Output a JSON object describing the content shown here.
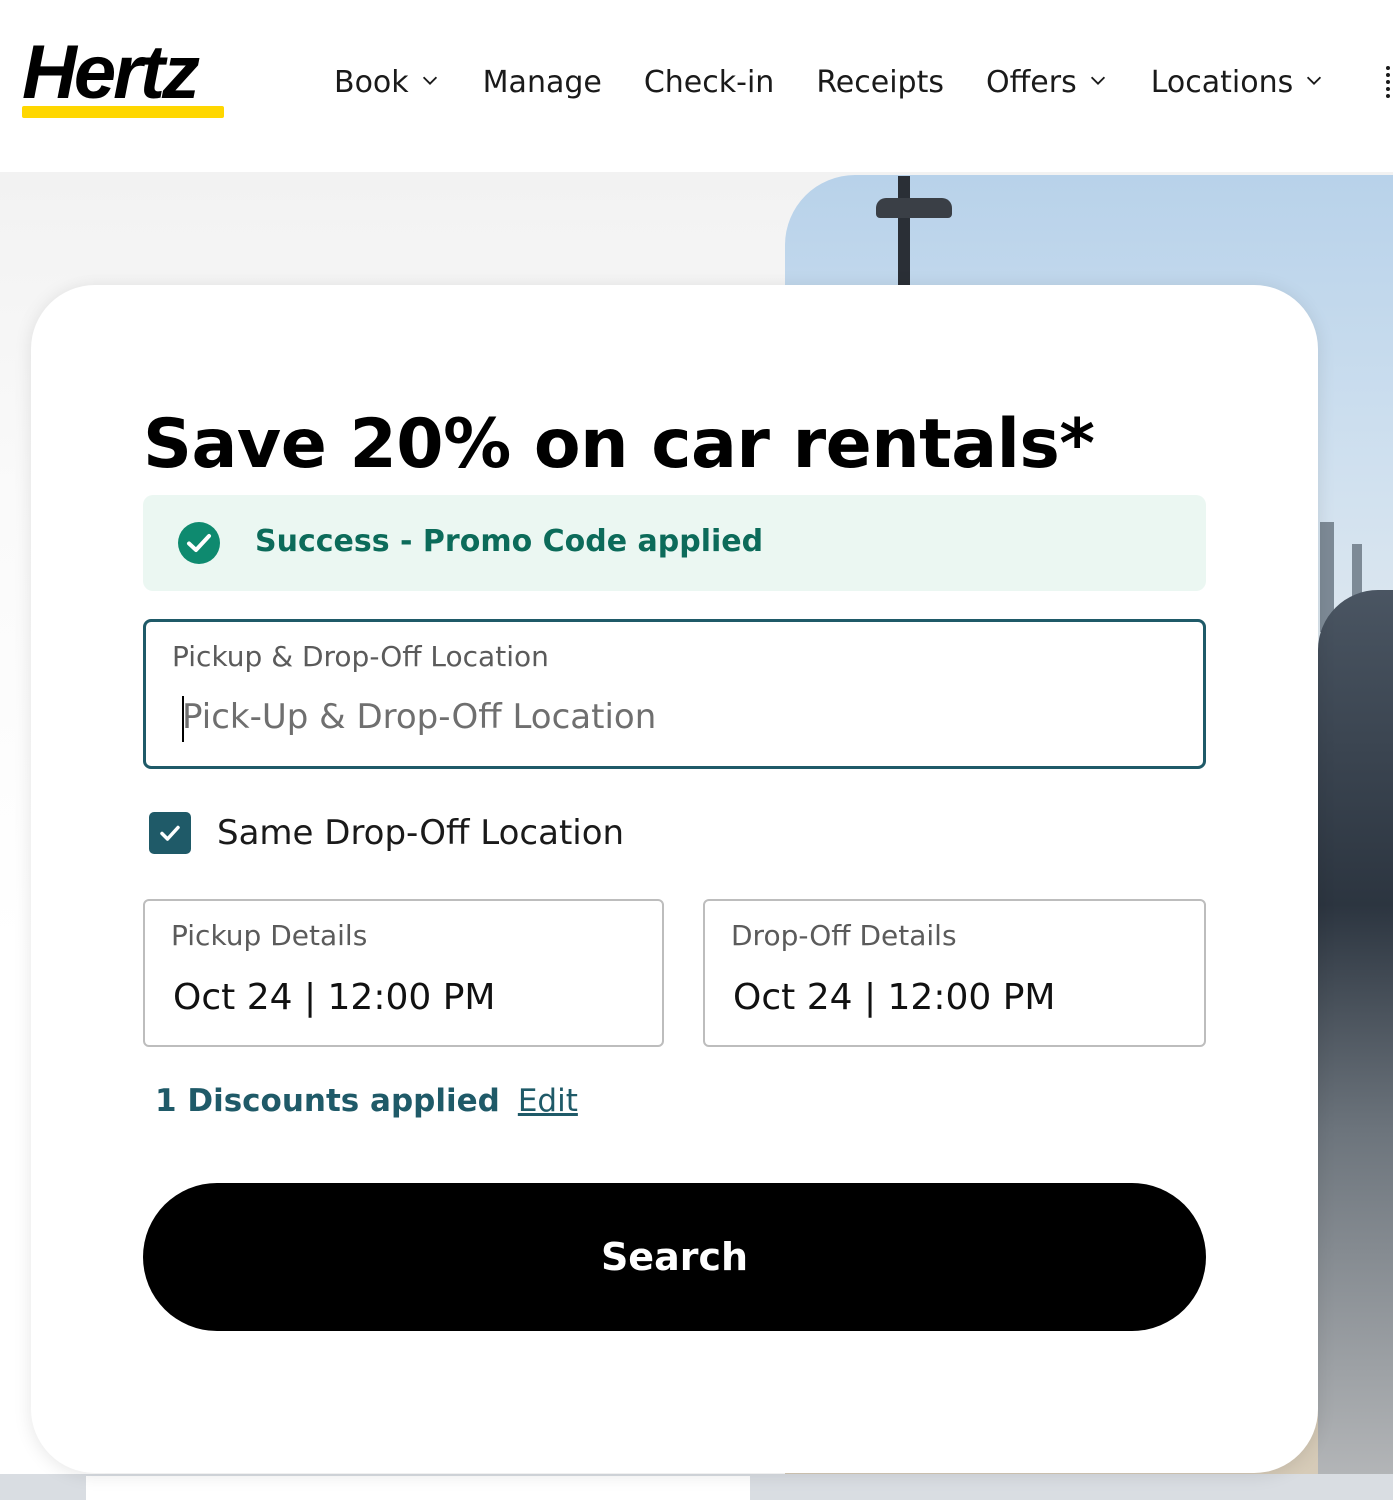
{
  "brand": {
    "name": "Hertz",
    "accent_color": "#ffd700"
  },
  "nav": {
    "items": [
      {
        "label": "Book",
        "has_dropdown": true,
        "icon": "chevron-down-icon"
      },
      {
        "label": "Manage",
        "has_dropdown": false
      },
      {
        "label": "Check-in",
        "has_dropdown": false
      },
      {
        "label": "Receipts",
        "has_dropdown": false
      },
      {
        "label": "Offers",
        "has_dropdown": true,
        "icon": "chevron-down-icon"
      },
      {
        "label": "Locations",
        "has_dropdown": true,
        "icon": "chevron-down-icon"
      }
    ]
  },
  "booking": {
    "title": "Save 20% on car rentals*",
    "alert": {
      "text": "Success - Promo Code applied",
      "icon": "check-circle-icon",
      "color": "#0c6b5a",
      "background": "#ebf7f2"
    },
    "location": {
      "label": "Pickup & Drop-Off Location",
      "placeholder": "Pick-Up & Drop-Off Location",
      "value": ""
    },
    "same_dropoff": {
      "label": "Same Drop-Off Location",
      "checked": true,
      "icon": "check-icon"
    },
    "pickup": {
      "label": "Pickup Details",
      "value": "Oct 24 | 12:00 PM"
    },
    "dropoff": {
      "label": "Drop-Off Details",
      "value": "Oct 24 | 12:00 PM"
    },
    "discounts": {
      "text": "1 Discounts applied",
      "edit_label": "Edit"
    },
    "search_label": "Search",
    "primary_color": "#1f5a68"
  }
}
